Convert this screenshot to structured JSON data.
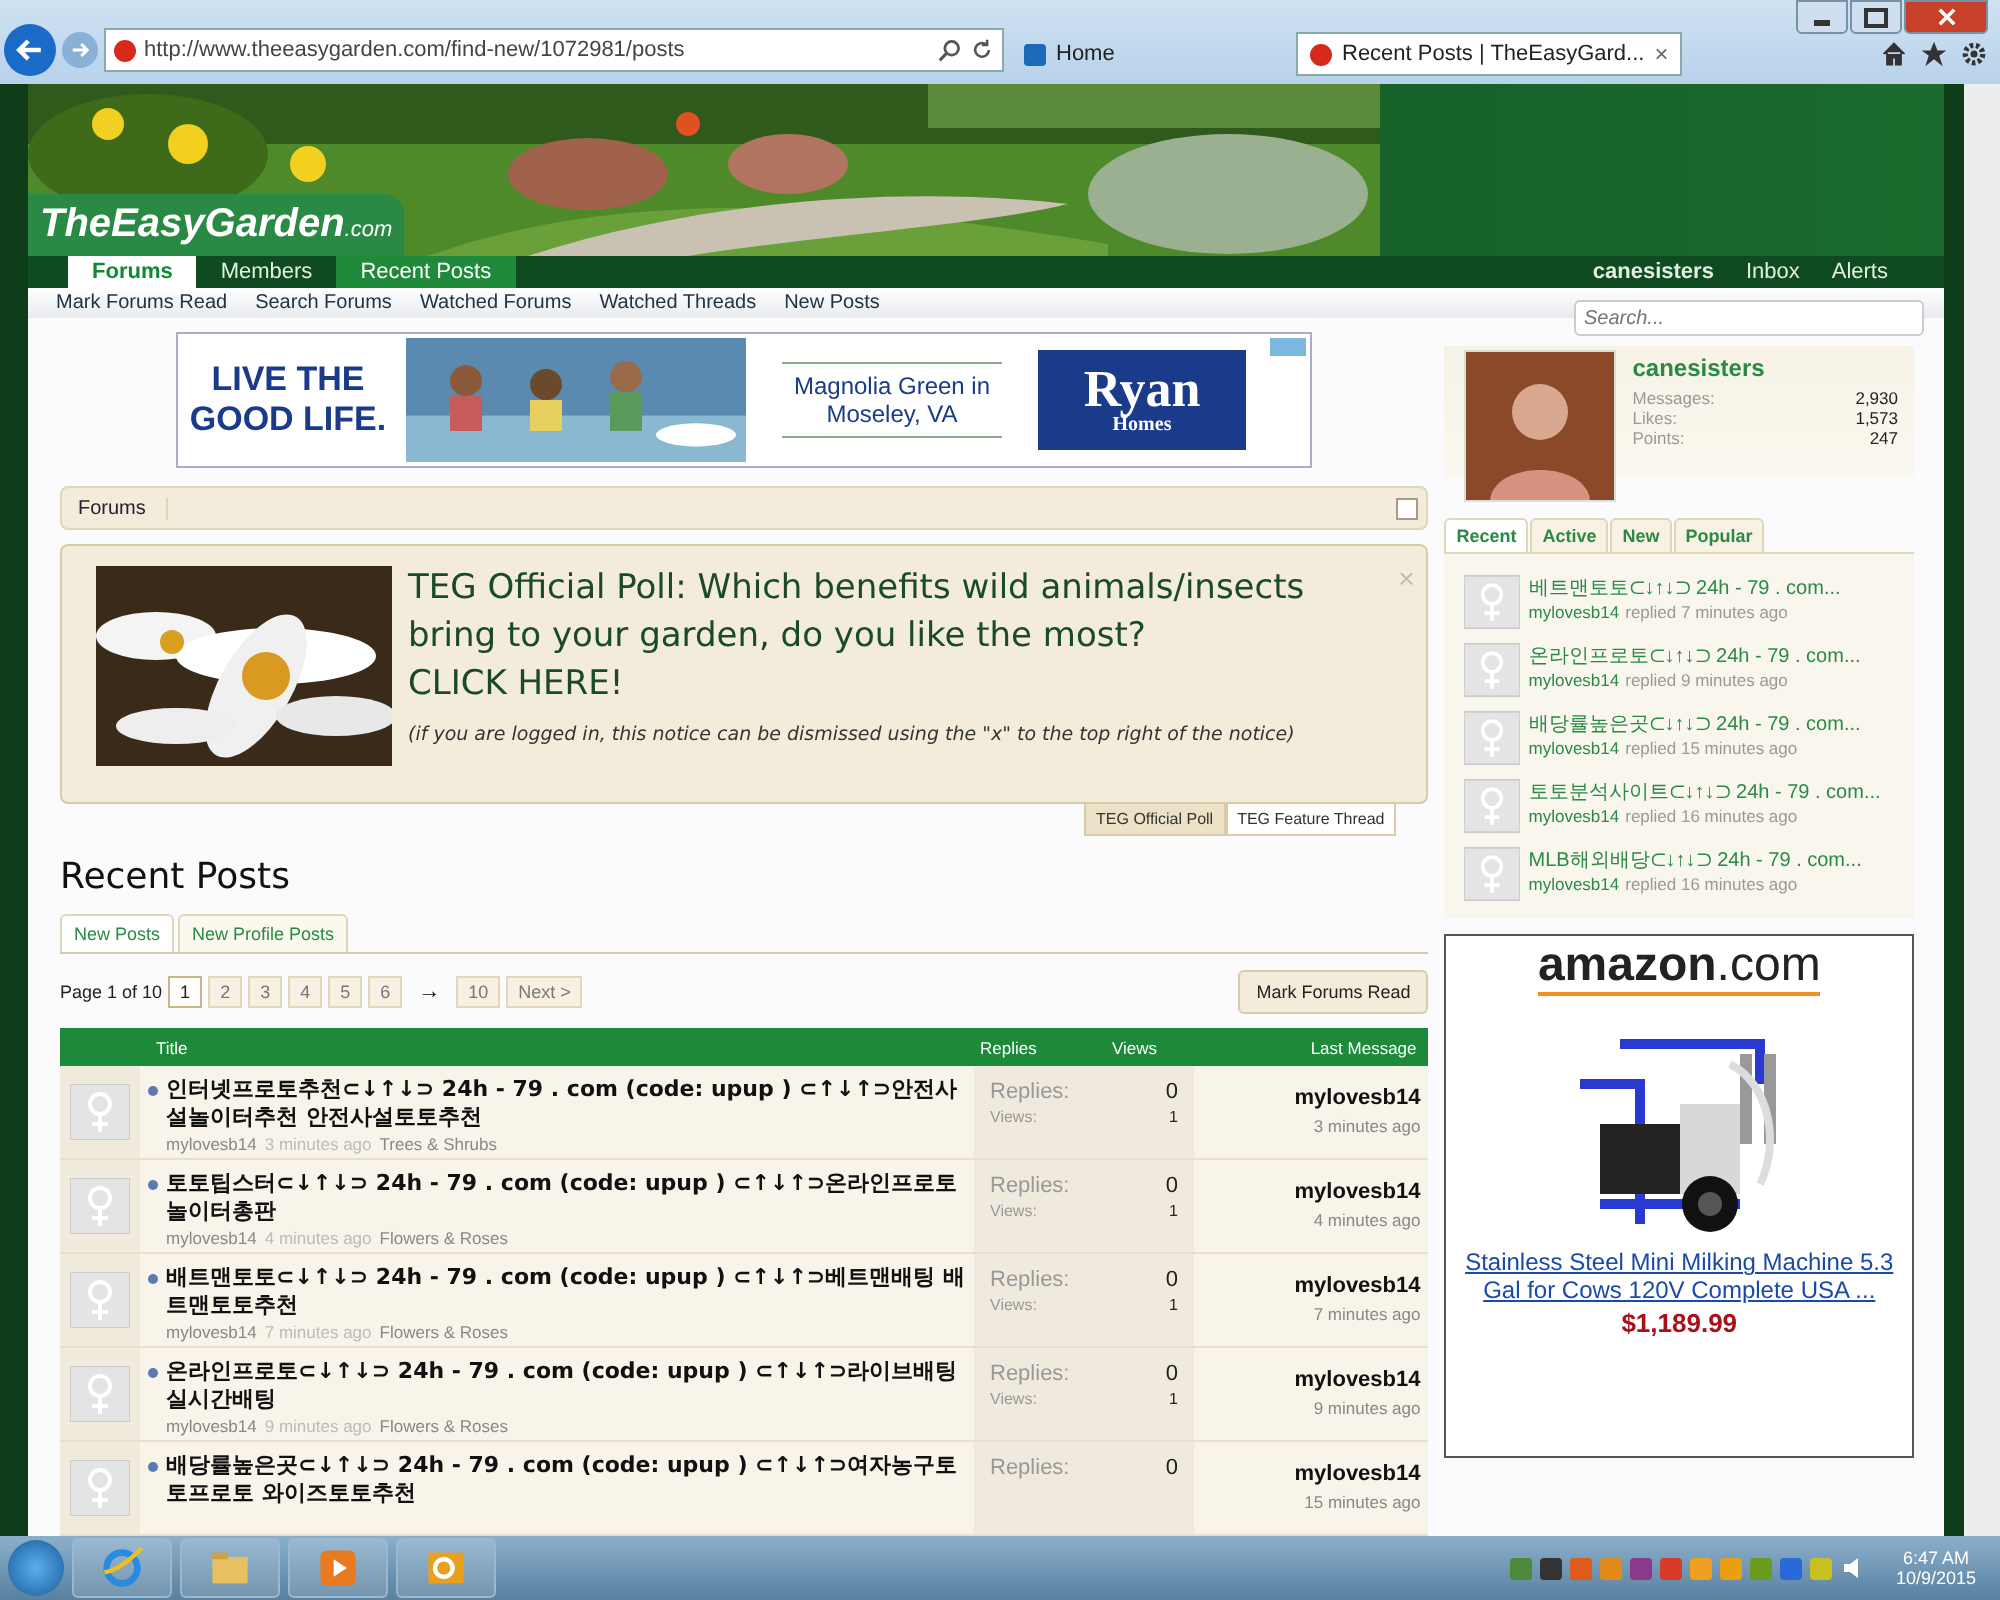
{
  "browser": {
    "address": "http://www.theeasygarden.com/find-new/1072981/posts",
    "tabs": [
      {
        "label": "Home",
        "selected": false
      },
      {
        "label": "Recent Posts | TheEasyGard...",
        "selected": true,
        "close": "×"
      }
    ]
  },
  "site": {
    "logo": "TheEasyGarden",
    "logo_suffix": ".com"
  },
  "nav": [
    {
      "label": "Forums",
      "selected": true,
      "highlighted": false
    },
    {
      "label": "Members",
      "selected": false,
      "highlighted": false
    },
    {
      "label": "Recent Posts",
      "selected": false,
      "highlighted": true
    }
  ],
  "user_nav": [
    "canesisters",
    "Inbox",
    "Alerts"
  ],
  "subnav": [
    "Mark Forums Read",
    "Search Forums",
    "Watched Forums",
    "Watched Threads",
    "New Posts"
  ],
  "search": {
    "placeholder": "Search..."
  },
  "banner_ad": {
    "slogan": "LIVE THE GOOD LIFE.",
    "location": "Magnolia Green in Moseley, VA",
    "brand_top": "Ryan",
    "brand_bottom": "Homes"
  },
  "breadcrumb": [
    "Forums"
  ],
  "notice": {
    "title": "TEG Official Poll: Which benefits wild animals/insects bring to your garden, do you like the most?",
    "cta": "CLICK HERE!",
    "hint": "(if you are logged in, this notice can be dismissed using the \"x\" to the top right of the notice)",
    "close": "×",
    "tabs": [
      {
        "label": "TEG Official Poll",
        "selected": true
      },
      {
        "label": "TEG Feature Thread",
        "selected": false
      }
    ]
  },
  "heading": "Recent Posts",
  "post_tabs": [
    {
      "label": "New Posts",
      "selected": true
    },
    {
      "label": "New Profile Posts",
      "selected": false
    }
  ],
  "pagination": {
    "summary": "Page 1 of 10",
    "pages": [
      {
        "label": "1",
        "selected": true
      },
      {
        "label": "2",
        "selected": false
      },
      {
        "label": "3",
        "selected": false
      },
      {
        "label": "4",
        "selected": false
      },
      {
        "label": "5",
        "selected": false
      },
      {
        "label": "6",
        "selected": false
      }
    ],
    "skip": "→",
    "last": "10",
    "next": "Next >"
  },
  "mark_read": "Mark Forums Read",
  "table": {
    "columns": [
      "Title",
      "Replies",
      "Views",
      "Last Message"
    ],
    "rows": [
      {
        "title": "인터넷프로토추천⊂↓↑↓⊃ 24h - 79 . com (code: upup ) ⊂↑↓↑⊃안전사설놀이터추천 안전사설토토추천",
        "author": "mylovesb14",
        "age": "3 minutes ago",
        "forum": "Trees & Shrubs",
        "replies_label": "Replies:",
        "replies": "0",
        "views_label": "Views:",
        "views": "1",
        "last_user": "mylovesb14",
        "last_time": "3 minutes ago"
      },
      {
        "title": "토토팁스터⊂↓↑↓⊃ 24h - 79 . com (code: upup ) ⊂↑↓↑⊃온라인프로토 놀이터총판",
        "author": "mylovesb14",
        "age": "4 minutes ago",
        "forum": "Flowers & Roses",
        "replies_label": "Replies:",
        "replies": "0",
        "views_label": "Views:",
        "views": "1",
        "last_user": "mylovesb14",
        "last_time": "4 minutes ago"
      },
      {
        "title": "배트맨토토⊂↓↑↓⊃ 24h - 79 . com (code: upup ) ⊂↑↓↑⊃베트맨배팅 배트맨토토추천",
        "author": "mylovesb14",
        "age": "7 minutes ago",
        "forum": "Flowers & Roses",
        "replies_label": "Replies:",
        "replies": "0",
        "views_label": "Views:",
        "views": "1",
        "last_user": "mylovesb14",
        "last_time": "7 minutes ago"
      },
      {
        "title": "온라인프로토⊂↓↑↓⊃ 24h - 79 . com (code: upup ) ⊂↑↓↑⊃라이브배팅 실시간배팅",
        "author": "mylovesb14",
        "age": "9 minutes ago",
        "forum": "Flowers & Roses",
        "replies_label": "Replies:",
        "replies": "0",
        "views_label": "Views:",
        "views": "1",
        "last_user": "mylovesb14",
        "last_time": "9 minutes ago"
      },
      {
        "title": "배당률높은곳⊂↓↑↓⊃ 24h - 79 . com (code: upup ) ⊂↑↓↑⊃여자농구토토프로토 와이즈토토추천",
        "replies_label": "Replies:",
        "replies": "0",
        "last_user": "mylovesb14",
        "last_time": "15 minutes ago"
      }
    ]
  },
  "profile": {
    "name": "canesisters",
    "stats": [
      {
        "label": "Messages:",
        "value": "2,930"
      },
      {
        "label": "Likes:",
        "value": "1,573"
      },
      {
        "label": "Points:",
        "value": "247"
      }
    ]
  },
  "side_tabs": [
    {
      "label": "Recent",
      "selected": true
    },
    {
      "label": "Active",
      "selected": false
    },
    {
      "label": "New",
      "selected": false
    },
    {
      "label": "Popular",
      "selected": false
    }
  ],
  "side_posts": [
    {
      "title": "베트맨토토⊂↓↑↓⊃ 24h - 79 . com...",
      "user": "mylovesb14",
      "action": "replied 7 minutes ago"
    },
    {
      "title": "온라인프로토⊂↓↑↓⊃ 24h - 79 . com...",
      "user": "mylovesb14",
      "action": "replied 9 minutes ago"
    },
    {
      "title": "배당률높은곳⊂↓↑↓⊃ 24h - 79 . com...",
      "user": "mylovesb14",
      "action": "replied 15 minutes ago"
    },
    {
      "title": "토토분석사이트⊂↓↑↓⊃ 24h - 79 . com...",
      "user": "mylovesb14",
      "action": "replied 16 minutes ago"
    },
    {
      "title": "MLB해외배당⊂↓↑↓⊃ 24h - 79 . com...",
      "user": "mylovesb14",
      "action": "replied 16 minutes ago"
    }
  ],
  "amazon_ad": {
    "logo": "amazon",
    "logo_suffix": ".com",
    "product": "Stainless Steel Mini Milking Machine 5.3 Gal for Cows 120V Complete USA ...",
    "price": "$1,189.99"
  },
  "taskbar": {
    "time": "6:47 AM",
    "date": "10/9/2015",
    "tray": [
      {
        "color": "#4a8a3a"
      },
      {
        "color": "#333333"
      },
      {
        "color": "#e05a1a"
      },
      {
        "color": "#e08a1a"
      },
      {
        "color": "#8a3a8a"
      },
      {
        "color": "#d83a2a"
      },
      {
        "color": "#f0a020"
      },
      {
        "color": "#e8a010"
      },
      {
        "color": "#6a9a20"
      },
      {
        "color": "#2a6ad8"
      },
      {
        "color": "#c8c020"
      }
    ]
  }
}
